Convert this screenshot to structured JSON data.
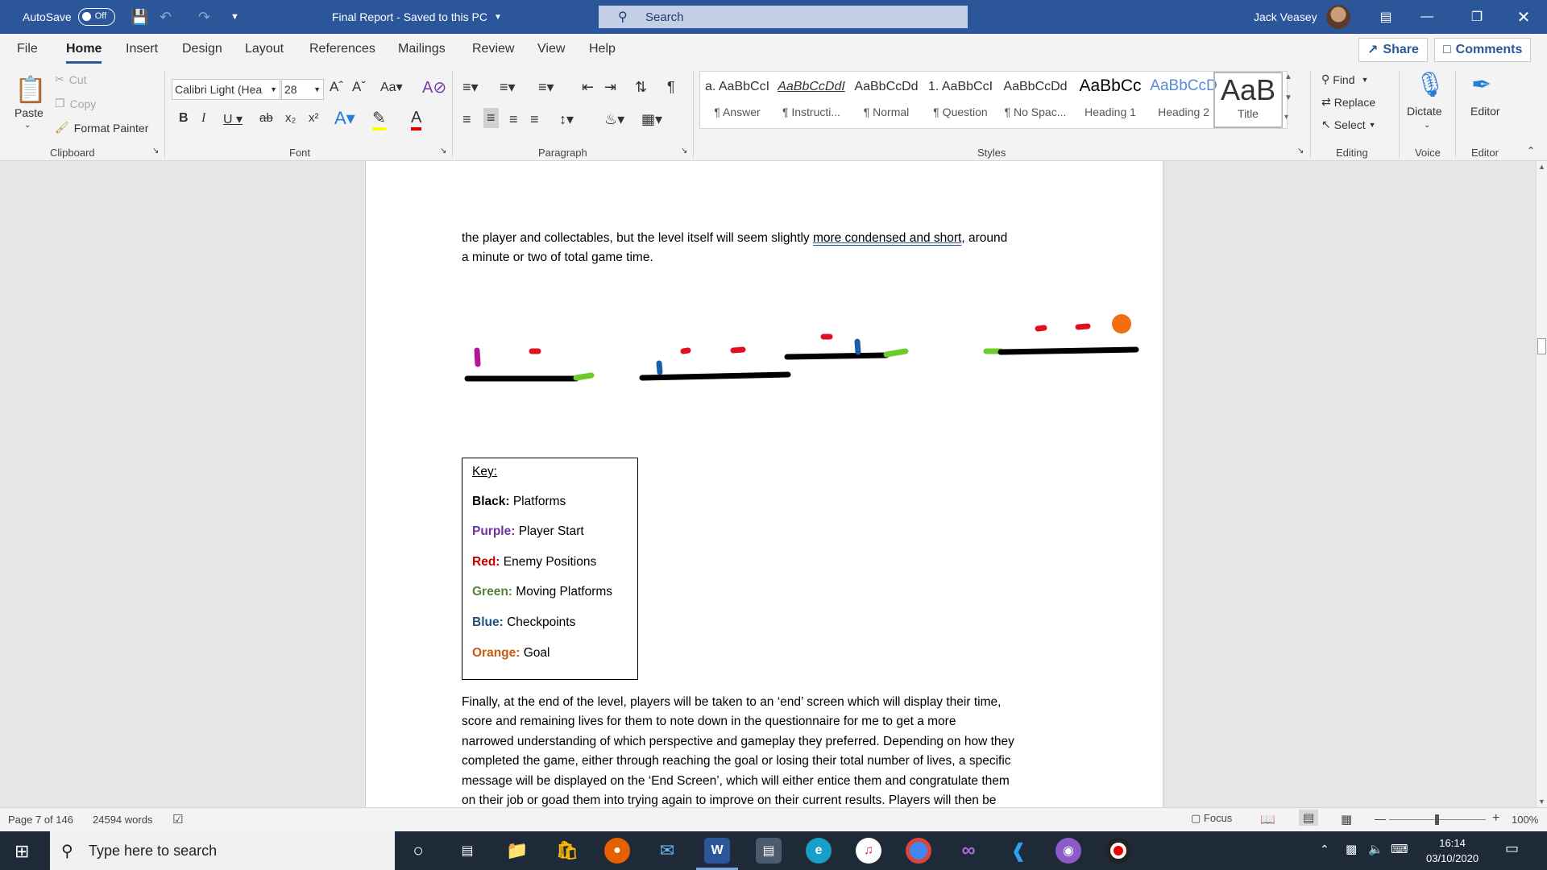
{
  "titlebar": {
    "autosave_label": "AutoSave",
    "autosave_state": "Off",
    "doc_title": "Final Report  -  Saved to this PC",
    "search_placeholder": "Search",
    "user_name": "Jack Veasey",
    "accent_color": "#2b579a"
  },
  "tabs": [
    "File",
    "Home",
    "Insert",
    "Design",
    "Layout",
    "References",
    "Mailings",
    "Review",
    "View",
    "Help"
  ],
  "active_tab": "Home",
  "share_label": "Share",
  "comments_label": "Comments",
  "ribbon": {
    "clipboard": {
      "paste": "Paste",
      "cut": "Cut",
      "copy": "Copy",
      "format_painter": "Format Painter",
      "label": "Clipboard"
    },
    "font": {
      "family": "Calibri Light (Hea",
      "size": "28",
      "label": "Font"
    },
    "paragraph": {
      "label": "Paragraph"
    },
    "styles": {
      "label": "Styles",
      "items": [
        {
          "sample": "a. AaBbCcI",
          "name": "¶ Answer"
        },
        {
          "sample": "AaBbCcDdI",
          "name": "¶ Instructi..."
        },
        {
          "sample": "AaBbCcDd",
          "name": "¶ Normal"
        },
        {
          "sample": "1. AaBbCcI",
          "name": "¶ Question"
        },
        {
          "sample": "AaBbCcDd",
          "name": "¶ No Spac..."
        },
        {
          "sample": "AaBbCc",
          "name": "Heading 1"
        },
        {
          "sample": "AaBbCcD",
          "name": "Heading 2"
        },
        {
          "sample": "AaB",
          "name": "Title"
        }
      ]
    },
    "editing": {
      "find": "Find",
      "replace": "Replace",
      "select": "Select",
      "label": "Editing"
    },
    "voice": {
      "dictate": "Dictate",
      "label": "Voice"
    },
    "editor": {
      "editor": "Editor",
      "label": "Editor"
    }
  },
  "document": {
    "para1_before": "the player and collectables, but the level itself will seem slightly ",
    "para1_link": "more condensed and short",
    "para1_after": ", around",
    "para1_line2": "a minute or two of total game time.",
    "key_title": "Key:",
    "key_items": [
      {
        "label": "Black:",
        "text": "Platforms",
        "color": "#000000"
      },
      {
        "label": "Purple:",
        "text": "Player Start",
        "color": "#7030a0"
      },
      {
        "label": "Red:",
        "text": "Enemy Positions",
        "color": "#c00000"
      },
      {
        "label": "Green:",
        "text": "Moving Platforms",
        "color": "#538135"
      },
      {
        "label": "Blue:",
        "text": "Checkpoints",
        "color": "#1f4e79"
      },
      {
        "label": "Orange:",
        "text": "Goal",
        "color": "#c55a11"
      }
    ],
    "para2_lines": [
      "Finally, at the end of the level, players will be taken to an ‘end’ screen which will display their time,",
      "score and remaining lives for them to note down in the questionnaire for me to get a more",
      "narrowed understanding of which perspective and gameplay they preferred. Depending on how they",
      "completed the game, either through reaching the goal or losing their total number of lives, a specific",
      "message will be displayed on the ‘End Screen’, which will either entice them and congratulate them",
      "on their job or goad them into trying again to improve on their current results. Players will then be"
    ]
  },
  "status": {
    "page": "Page 7 of 146",
    "words": "24594 words",
    "focus": "Focus",
    "zoom": "100%"
  },
  "taskbar": {
    "search_placeholder": "Type here to search",
    "time": "16:14",
    "date": "03/10/2020"
  }
}
